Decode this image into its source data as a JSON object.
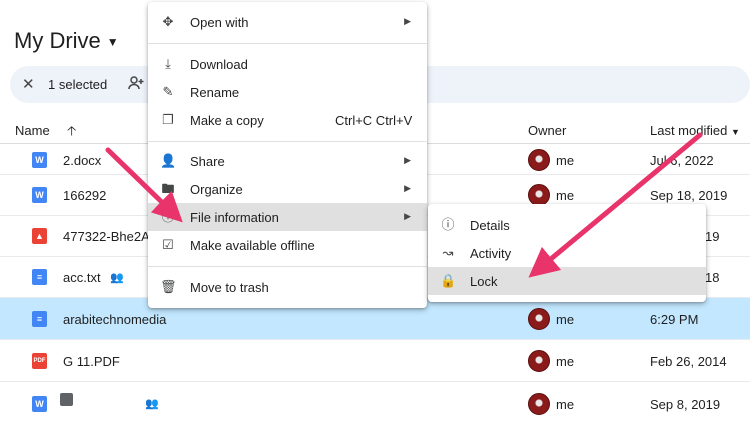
{
  "header": {
    "title": "My Drive"
  },
  "selection": {
    "count_label": "1 selected"
  },
  "columns": {
    "name": "Name",
    "owner": "Owner",
    "last_modified": "Last modified"
  },
  "rows": [
    {
      "name": "2.docx",
      "icon": "word-icon",
      "owner": "me",
      "date": "Jul 6, 2022"
    },
    {
      "name": "166292",
      "icon": "word-icon",
      "owner": "me",
      "date": "Sep 18, 2019"
    },
    {
      "name": "477322-Bhe2A",
      "icon": "image-icon",
      "owner": "",
      "date": "19"
    },
    {
      "name": "acc.txt",
      "icon": "doc-icon",
      "shared": true,
      "owner": "",
      "date": "18"
    },
    {
      "name": "arabitechnomedia",
      "icon": "doc-icon",
      "owner": "me",
      "date": "6:29 PM",
      "selected": true
    },
    {
      "name": "G 11.PDF",
      "icon": "pdf-icon",
      "owner": "me",
      "date": "Feb 26, 2014"
    },
    {
      "name": "",
      "icon": "word-icon",
      "shared": true,
      "owner": "me",
      "date": "Sep 8, 2019"
    }
  ],
  "context_menu": {
    "open_with": "Open with",
    "download": "Download",
    "rename": "Rename",
    "make_copy": "Make a copy",
    "make_copy_shortcut": "Ctrl+C Ctrl+V",
    "share": "Share",
    "organize": "Organize",
    "file_information": "File information",
    "offline": "Make available offline",
    "trash": "Move to trash"
  },
  "submenu": {
    "details": "Details",
    "activity": "Activity",
    "lock": "Lock"
  },
  "colors": {
    "selected_row": "#c2e7ff",
    "annotation_arrow": "#e8336b",
    "menu_hover": "#e0e0e0"
  },
  "icon_glyphs": {
    "word": "W",
    "pdf": "PDF"
  }
}
